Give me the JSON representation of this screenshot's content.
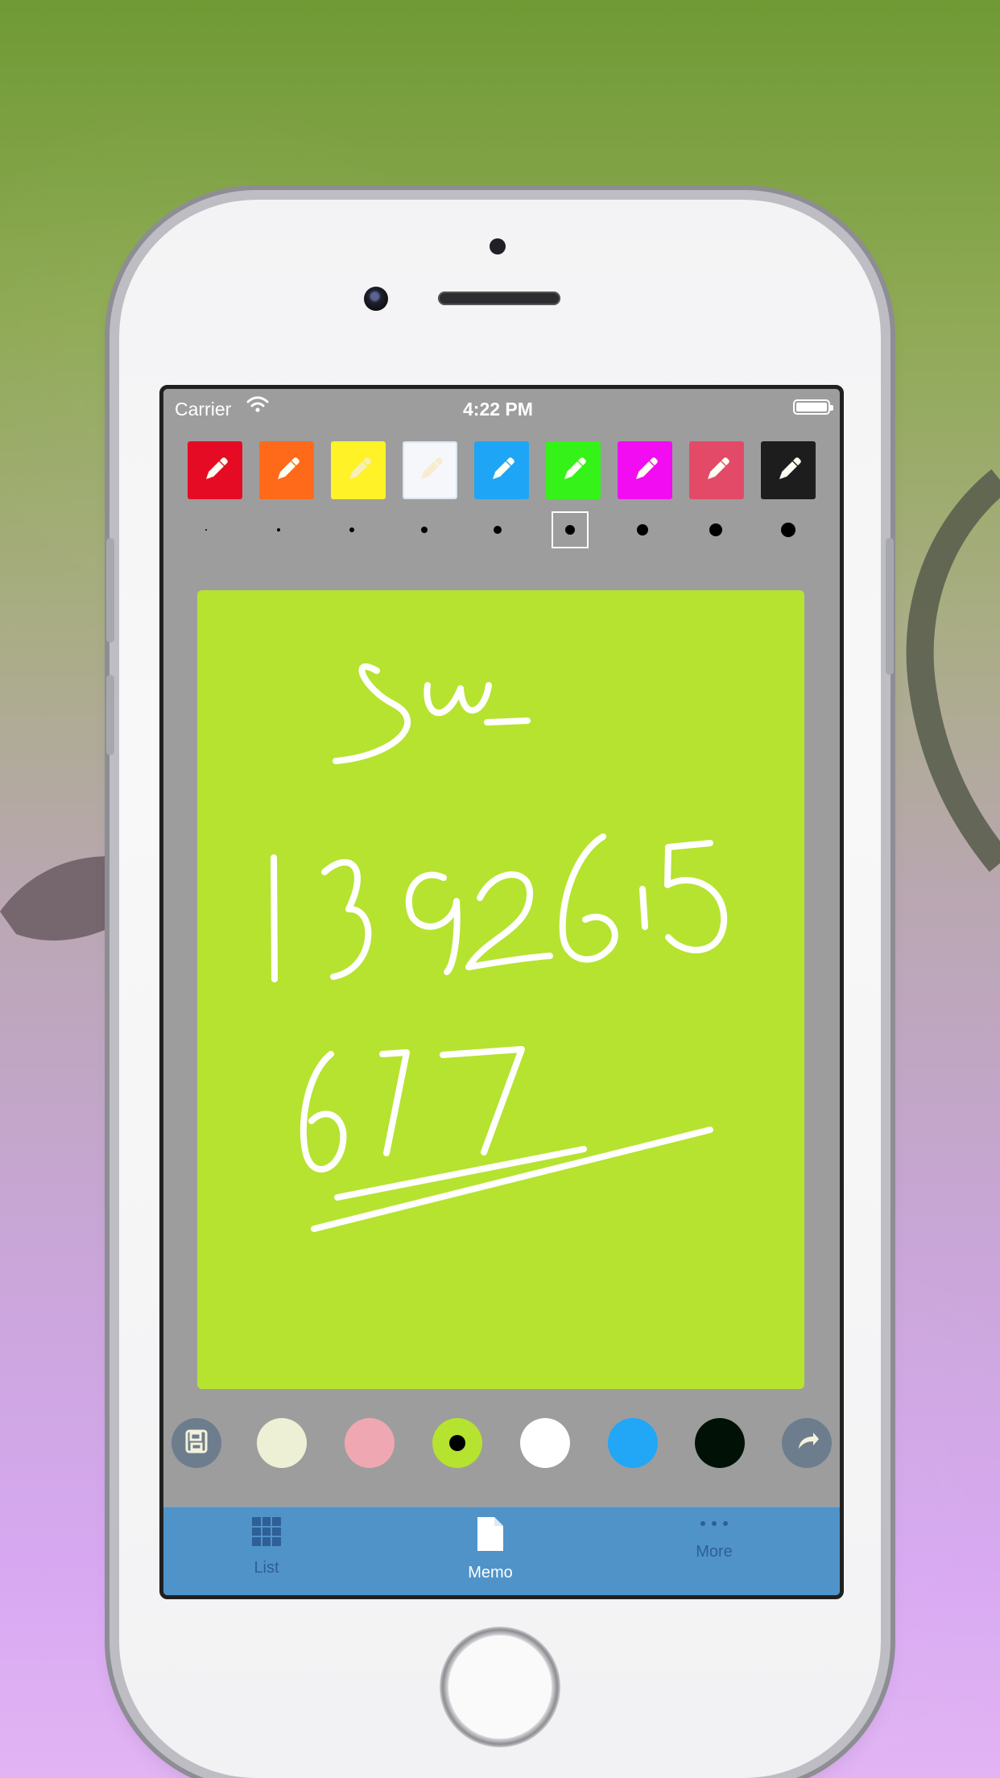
{
  "status_bar": {
    "carrier": "Carrier",
    "time": "4:22 PM",
    "battery": "full"
  },
  "pen_colors": [
    {
      "name": "red",
      "color": "#e60b24",
      "icon": "pencil-icon"
    },
    {
      "name": "orange",
      "color": "#ff6a1a",
      "icon": "pencil-icon"
    },
    {
      "name": "yellow",
      "color": "#fff227",
      "icon": "pencil-icon"
    },
    {
      "name": "white",
      "color": "#f5f7fb",
      "icon": "pencil-icon"
    },
    {
      "name": "blue",
      "color": "#1ea5f5",
      "icon": "pencil-icon"
    },
    {
      "name": "green",
      "color": "#35f219",
      "icon": "pencil-icon"
    },
    {
      "name": "magenta",
      "color": "#f20cf2",
      "icon": "pencil-icon"
    },
    {
      "name": "rose",
      "color": "#e34a68",
      "icon": "pencil-icon"
    },
    {
      "name": "black",
      "color": "#1d1d1d",
      "icon": "pencil-icon"
    }
  ],
  "brush_sizes": [
    1,
    2,
    3,
    4,
    5,
    6,
    7,
    8,
    9
  ],
  "selected_brush_size": 6,
  "canvas": {
    "background": "#b5e330",
    "handwriting": [
      "Su",
      "1392615",
      "677"
    ]
  },
  "bottom_toolbar": {
    "left_icon": "save-icon",
    "right_icon": "share-icon",
    "swatches": [
      {
        "color": "#eef0d6",
        "selected": false
      },
      {
        "color": "#efa8b1",
        "selected": false
      },
      {
        "color": "#b5e330",
        "selected": true
      },
      {
        "color": "#ffffff",
        "selected": false
      },
      {
        "color": "#21a7f6",
        "selected": false
      },
      {
        "color": "#021105",
        "selected": false
      }
    ]
  },
  "tabs": [
    {
      "label": "List",
      "icon": "grid-icon",
      "active": false
    },
    {
      "label": "Memo",
      "icon": "document-icon",
      "active": true
    },
    {
      "label": "More",
      "icon": "more-icon",
      "active": false
    }
  ]
}
